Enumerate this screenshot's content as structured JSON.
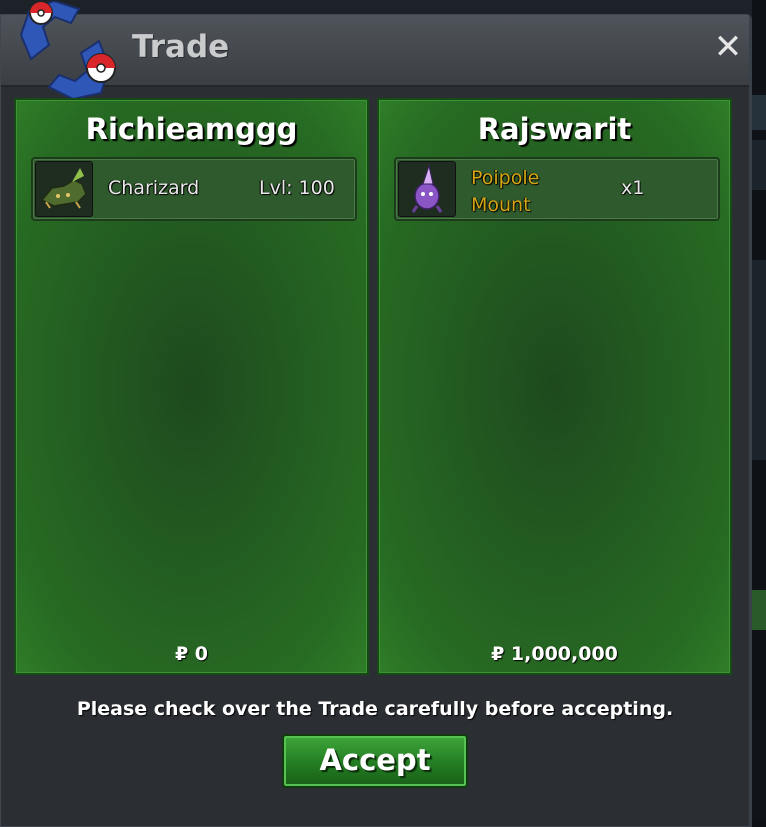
{
  "window": {
    "title": "Trade",
    "close_symbol": "✕"
  },
  "colors": {
    "panel_green": "#276b23",
    "item_gold": "#d4a514",
    "accept_green": "#2f8f2c"
  },
  "left_player": {
    "name": "Richieamggg",
    "offer": {
      "icon": "charizard-sprite-icon",
      "name": "Charizard",
      "level": "Lvl: 100"
    },
    "money": "₽ 0"
  },
  "right_player": {
    "name": "Rajswarit",
    "offer": {
      "icon": "poipole-sprite-icon",
      "name_line1": "Poipole",
      "name_line2": "Mount",
      "quantity": "x1"
    },
    "money": "₽ 1,000,000"
  },
  "footer": {
    "notice": "Please check over the Trade carefully before accepting.",
    "accept_label": "Accept"
  }
}
